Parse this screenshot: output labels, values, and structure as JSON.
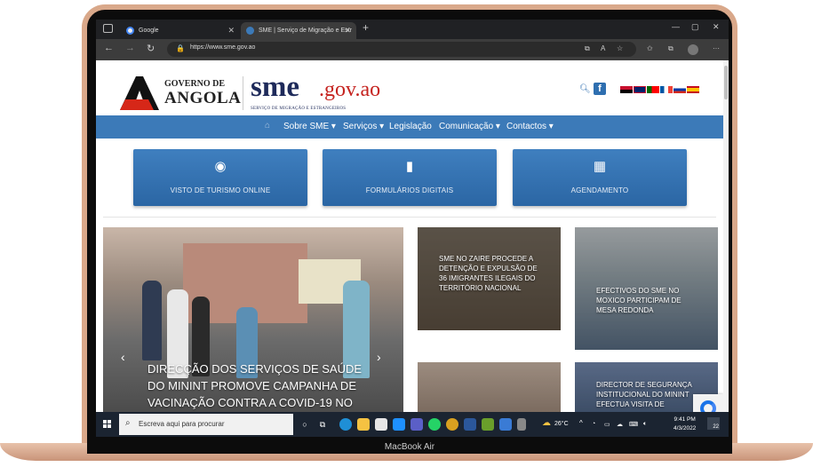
{
  "device": {
    "label": "MacBook Air"
  },
  "browser": {
    "tabs": [
      {
        "title": "Google",
        "active": false
      },
      {
        "title": "SME | Serviço de Migração e Estr",
        "active": true
      }
    ],
    "new_tab": "+",
    "url": "https://www.sme.gov.ao"
  },
  "site": {
    "gov_line1": "GOVERNO DE",
    "gov_line2": "ANGOLA",
    "brand_main": "sme",
    "brand_domain": ".gov.ao",
    "brand_sub": "SERVIÇO DE MIGRAÇÃO E ESTRANGEIROS",
    "colors": {
      "primary": "#3c7ab8",
      "brand_navy": "#1e2a5a",
      "brand_red": "#c5231f"
    },
    "nav": [
      {
        "label": "Sobre SME",
        "dropdown": true
      },
      {
        "label": "Serviços",
        "dropdown": true
      },
      {
        "label": "Legislação",
        "dropdown": false
      },
      {
        "label": "Comunicação",
        "dropdown": true
      },
      {
        "label": "Contactos",
        "dropdown": true
      }
    ],
    "quick_links": [
      {
        "label": "VISTO DE TURISMO ONLINE",
        "icon": "globe-icon"
      },
      {
        "label": "FORMULÁRIOS DIGITAIS",
        "icon": "document-icon"
      },
      {
        "label": "AGENDAMENTO",
        "icon": "calendar-icon"
      }
    ],
    "hero_caption": "DIRECÇÃO DOS SERVIÇOS DE SAÚDE DO MININT PROMOVE CAMPANHA DE VACINAÇÃO CONTRA A COVID-19 NO",
    "news": [
      {
        "caption": "SME NO ZAIRE PROCEDE A DETENÇÃO E EXPULSÃO DE 36 IMIGRANTES ILEGAIS DO TERRITÓRIO NACIONAL"
      },
      {
        "caption": "EFECTIVOS DO SME NO MOXICO PARTICIPAM DE MESA REDONDA"
      },
      {
        "caption": ""
      },
      {
        "caption": "DIRECTOR DE SEGURANÇA INSTITUCIONAL DO MININT EFECTUA VISITA DE"
      }
    ]
  },
  "taskbar": {
    "search_placeholder": "Escreva aqui para procurar",
    "weather": "26°C",
    "time": "9:41 PM",
    "date": "4/3/2022",
    "notifications": "22"
  }
}
